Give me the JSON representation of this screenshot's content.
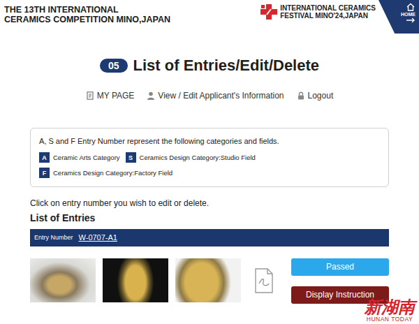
{
  "header": {
    "competition_title": [
      "THE 13TH INTERNATIONAL",
      "CERAMICS COMPETITION MINO,JAPAN"
    ],
    "festival_title": [
      "INTERNATIONAL CERAMICS",
      "FESTIVAL MINO'24,JAPAN"
    ],
    "home": "HOME"
  },
  "step": {
    "number": "05",
    "title": "List of Entries/Edit/Delete"
  },
  "nav_links": [
    {
      "label": "MY PAGE",
      "kind": "page"
    },
    {
      "label": "View / Edit Applicant's Information",
      "kind": "user"
    },
    {
      "label": "Logout",
      "kind": "lock"
    }
  ],
  "legend": {
    "intro": "A, S and F Entry Number represent the following categories and fields.",
    "items": [
      {
        "code": "A",
        "label": "Ceramic Arts Category"
      },
      {
        "code": "S",
        "label": "Ceramics Design Category:Studio Field"
      },
      {
        "code": "F",
        "label": "Ceramics Design Category:Factory Field"
      }
    ]
  },
  "instruction": "Click on entry number you wish to edit or delete.",
  "list_title": "List of Entries",
  "entries": [
    {
      "number_label": "Entry Number",
      "number": "W-0707-A1",
      "attachments": [
        {
          "kind": "photo"
        },
        {
          "kind": "photo"
        },
        {
          "kind": "photo"
        },
        {
          "kind": "pdf"
        }
      ],
      "buttons": [
        {
          "label": "Passed",
          "kind": "status"
        },
        {
          "label": "Display Instruction",
          "kind": "action"
        }
      ]
    }
  ],
  "watermark": {
    "text": "新湖南",
    "subtext": "HUNAN TODAY"
  }
}
